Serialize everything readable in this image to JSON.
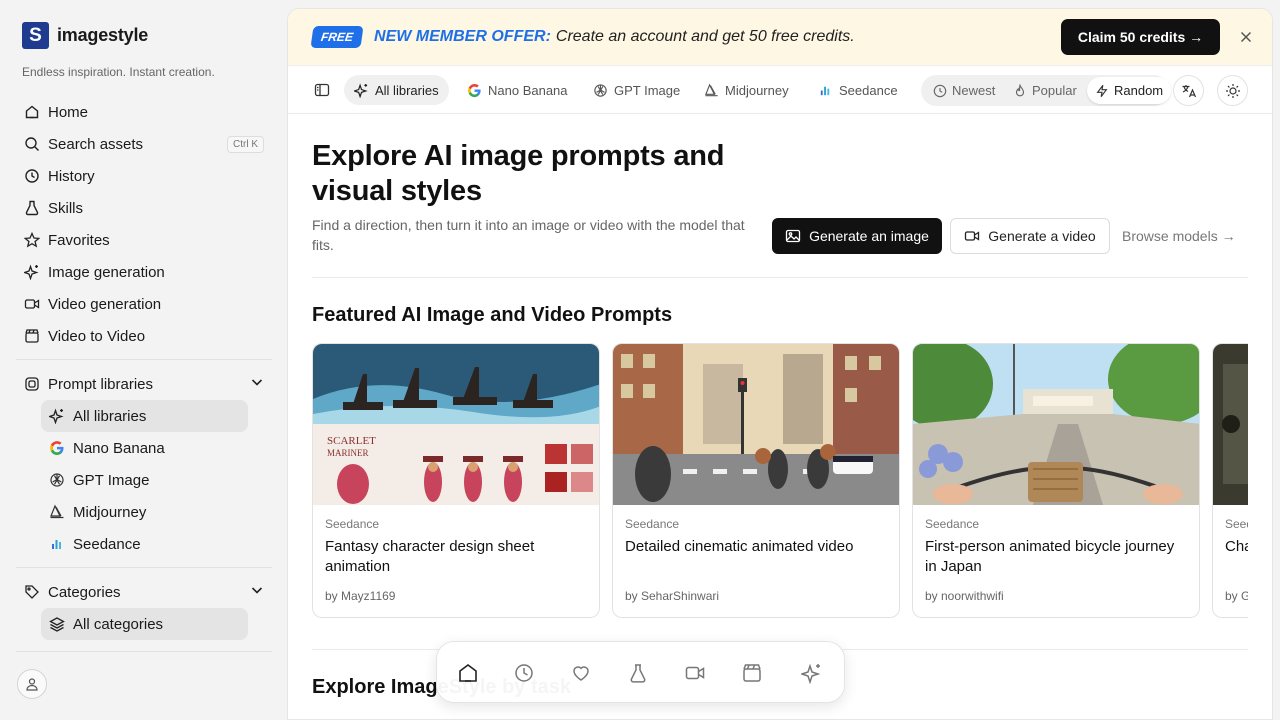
{
  "brand": {
    "name": "imagestyle",
    "tagline": "Endless inspiration. Instant creation."
  },
  "sidebar": {
    "nav": [
      {
        "label": "Home",
        "icon": "home-icon"
      },
      {
        "label": "Search assets",
        "icon": "search-icon",
        "shortcut": "Ctrl K"
      },
      {
        "label": "History",
        "icon": "history-icon"
      },
      {
        "label": "Skills",
        "icon": "flask-icon"
      },
      {
        "label": "Favorites",
        "icon": "star-icon"
      },
      {
        "label": "Image generation",
        "icon": "sparkle-icon"
      },
      {
        "label": "Video generation",
        "icon": "video-camera-icon"
      },
      {
        "label": "Video to Video",
        "icon": "clapper-icon"
      }
    ],
    "prompt_libraries": {
      "label": "Prompt libraries",
      "items": [
        {
          "label": "All libraries",
          "icon": "sparkle-icon",
          "active": true
        },
        {
          "label": "Nano Banana",
          "icon": "google-g-icon"
        },
        {
          "label": "GPT Image",
          "icon": "openai-icon"
        },
        {
          "label": "Midjourney",
          "icon": "midjourney-sail-icon"
        },
        {
          "label": "Seedance",
          "icon": "seedance-bars-icon"
        }
      ]
    },
    "categories": {
      "label": "Categories",
      "items": [
        {
          "label": "All categories",
          "icon": "layers-icon",
          "active": true
        }
      ]
    }
  },
  "banner": {
    "badge": "FREE",
    "title": "NEW MEMBER OFFER:",
    "text": "Create an account and get 50 free credits.",
    "cta": "Claim 50 credits →"
  },
  "toolbar": {
    "filters": [
      {
        "label": "All libraries",
        "active": true
      },
      {
        "label": "Nano Banana"
      },
      {
        "label": "GPT Image"
      },
      {
        "label": "Midjourney"
      },
      {
        "label": "Seedance"
      }
    ],
    "sort": [
      {
        "label": "Newest"
      },
      {
        "label": "Popular"
      },
      {
        "label": "Random",
        "active": true
      }
    ]
  },
  "hero": {
    "title": "Explore AI image prompts and visual styles",
    "subtitle": "Find a direction, then turn it into an image or video with the model that fits.",
    "generate_image": "Generate an image",
    "generate_video": "Generate a video",
    "browse_models": "Browse models →"
  },
  "featured": {
    "title": "Featured AI Image and Video Prompts",
    "cards": [
      {
        "category": "Seedance",
        "title": "Fantasy character design sheet animation",
        "author": "by Mayz1169"
      },
      {
        "category": "Seedance",
        "title": "Detailed cinematic animated video",
        "author": "by SeharShinwari"
      },
      {
        "category": "Seedance",
        "title": "First-person animated bicycle journey in Japan",
        "author": "by noorwithwifi"
      },
      {
        "category": "Seedance",
        "title": "Cha… por…",
        "author": "by G…"
      }
    ]
  },
  "explore": {
    "title": "Explore ImageStyle by task"
  },
  "dock": [
    "home-icon",
    "history-icon",
    "heart-icon",
    "flask-icon",
    "video-camera-icon",
    "clapper-icon",
    "sparkle-icon"
  ],
  "colors": {
    "accent": "#1e6fe8",
    "banner_bg": "#fdf7e3",
    "dark_button": "#111111"
  }
}
